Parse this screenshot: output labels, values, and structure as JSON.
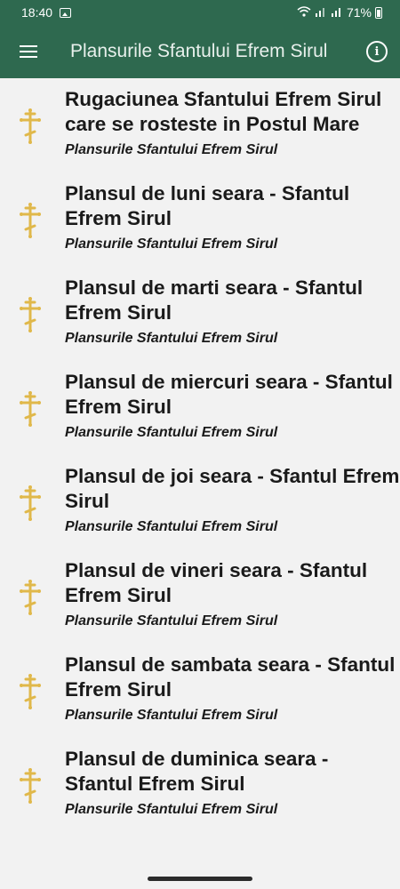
{
  "status_bar": {
    "time": "18:40",
    "battery": "71%",
    "icons": [
      "photo-icon",
      "wifi-icon",
      "signal-icon",
      "signal-icon",
      "battery-icon"
    ]
  },
  "app_bar": {
    "title": "Plansurile Sfantului Efrem Sirul",
    "menu_icon": "hamburger-menu-icon",
    "info_icon": "info-icon",
    "color": "#2e694f"
  },
  "list": {
    "item_icon": "orthodox-cross-icon",
    "icon_color": "#e0b84a",
    "items": [
      {
        "title": "Rugaciunea Sfantului Efrem Sirul care se rosteste in Postul Mare",
        "subtitle": "Plansurile Sfantului Efrem Sirul"
      },
      {
        "title": "Plansul de luni seara - Sfantul Efrem Sirul",
        "subtitle": "Plansurile Sfantului Efrem Sirul"
      },
      {
        "title": "Plansul de marti seara - Sfantul Efrem Sirul",
        "subtitle": "Plansurile Sfantului Efrem Sirul"
      },
      {
        "title": "Plansul de miercuri seara - Sfantul Efrem Sirul",
        "subtitle": "Plansurile Sfantului Efrem Sirul"
      },
      {
        "title": "Plansul de joi seara - Sfantul Efrem Sirul",
        "subtitle": "Plansurile Sfantului Efrem Sirul"
      },
      {
        "title": "Plansul de vineri seara - Sfantul Efrem Sirul",
        "subtitle": "Plansurile Sfantului Efrem Sirul"
      },
      {
        "title": "Plansul de sambata seara - Sfantul Efrem Sirul",
        "subtitle": "Plansurile Sfantului Efrem Sirul"
      },
      {
        "title": "Plansul de duminica seara - Sfantul Efrem Sirul",
        "subtitle": "Plansurile Sfantului Efrem Sirul"
      }
    ]
  }
}
